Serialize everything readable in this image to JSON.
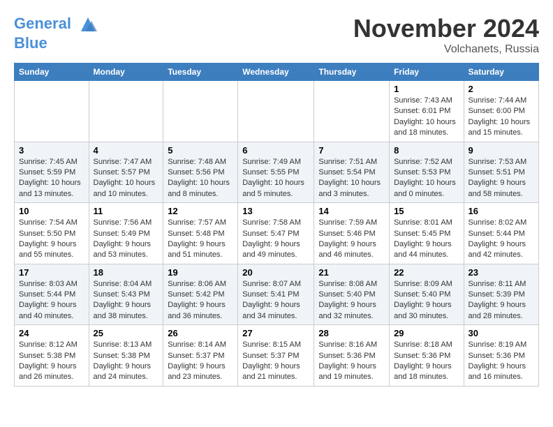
{
  "header": {
    "logo_line1": "General",
    "logo_line2": "Blue",
    "month": "November 2024",
    "location": "Volchanets, Russia"
  },
  "weekdays": [
    "Sunday",
    "Monday",
    "Tuesday",
    "Wednesday",
    "Thursday",
    "Friday",
    "Saturday"
  ],
  "weeks": [
    [
      {
        "day": "",
        "info": ""
      },
      {
        "day": "",
        "info": ""
      },
      {
        "day": "",
        "info": ""
      },
      {
        "day": "",
        "info": ""
      },
      {
        "day": "",
        "info": ""
      },
      {
        "day": "1",
        "info": "Sunrise: 7:43 AM\nSunset: 6:01 PM\nDaylight: 10 hours and 18 minutes."
      },
      {
        "day": "2",
        "info": "Sunrise: 7:44 AM\nSunset: 6:00 PM\nDaylight: 10 hours and 15 minutes."
      }
    ],
    [
      {
        "day": "3",
        "info": "Sunrise: 7:45 AM\nSunset: 5:59 PM\nDaylight: 10 hours and 13 minutes."
      },
      {
        "day": "4",
        "info": "Sunrise: 7:47 AM\nSunset: 5:57 PM\nDaylight: 10 hours and 10 minutes."
      },
      {
        "day": "5",
        "info": "Sunrise: 7:48 AM\nSunset: 5:56 PM\nDaylight: 10 hours and 8 minutes."
      },
      {
        "day": "6",
        "info": "Sunrise: 7:49 AM\nSunset: 5:55 PM\nDaylight: 10 hours and 5 minutes."
      },
      {
        "day": "7",
        "info": "Sunrise: 7:51 AM\nSunset: 5:54 PM\nDaylight: 10 hours and 3 minutes."
      },
      {
        "day": "8",
        "info": "Sunrise: 7:52 AM\nSunset: 5:53 PM\nDaylight: 10 hours and 0 minutes."
      },
      {
        "day": "9",
        "info": "Sunrise: 7:53 AM\nSunset: 5:51 PM\nDaylight: 9 hours and 58 minutes."
      }
    ],
    [
      {
        "day": "10",
        "info": "Sunrise: 7:54 AM\nSunset: 5:50 PM\nDaylight: 9 hours and 55 minutes."
      },
      {
        "day": "11",
        "info": "Sunrise: 7:56 AM\nSunset: 5:49 PM\nDaylight: 9 hours and 53 minutes."
      },
      {
        "day": "12",
        "info": "Sunrise: 7:57 AM\nSunset: 5:48 PM\nDaylight: 9 hours and 51 minutes."
      },
      {
        "day": "13",
        "info": "Sunrise: 7:58 AM\nSunset: 5:47 PM\nDaylight: 9 hours and 49 minutes."
      },
      {
        "day": "14",
        "info": "Sunrise: 7:59 AM\nSunset: 5:46 PM\nDaylight: 9 hours and 46 minutes."
      },
      {
        "day": "15",
        "info": "Sunrise: 8:01 AM\nSunset: 5:45 PM\nDaylight: 9 hours and 44 minutes."
      },
      {
        "day": "16",
        "info": "Sunrise: 8:02 AM\nSunset: 5:44 PM\nDaylight: 9 hours and 42 minutes."
      }
    ],
    [
      {
        "day": "17",
        "info": "Sunrise: 8:03 AM\nSunset: 5:44 PM\nDaylight: 9 hours and 40 minutes."
      },
      {
        "day": "18",
        "info": "Sunrise: 8:04 AM\nSunset: 5:43 PM\nDaylight: 9 hours and 38 minutes."
      },
      {
        "day": "19",
        "info": "Sunrise: 8:06 AM\nSunset: 5:42 PM\nDaylight: 9 hours and 36 minutes."
      },
      {
        "day": "20",
        "info": "Sunrise: 8:07 AM\nSunset: 5:41 PM\nDaylight: 9 hours and 34 minutes."
      },
      {
        "day": "21",
        "info": "Sunrise: 8:08 AM\nSunset: 5:40 PM\nDaylight: 9 hours and 32 minutes."
      },
      {
        "day": "22",
        "info": "Sunrise: 8:09 AM\nSunset: 5:40 PM\nDaylight: 9 hours and 30 minutes."
      },
      {
        "day": "23",
        "info": "Sunrise: 8:11 AM\nSunset: 5:39 PM\nDaylight: 9 hours and 28 minutes."
      }
    ],
    [
      {
        "day": "24",
        "info": "Sunrise: 8:12 AM\nSunset: 5:38 PM\nDaylight: 9 hours and 26 minutes."
      },
      {
        "day": "25",
        "info": "Sunrise: 8:13 AM\nSunset: 5:38 PM\nDaylight: 9 hours and 24 minutes."
      },
      {
        "day": "26",
        "info": "Sunrise: 8:14 AM\nSunset: 5:37 PM\nDaylight: 9 hours and 23 minutes."
      },
      {
        "day": "27",
        "info": "Sunrise: 8:15 AM\nSunset: 5:37 PM\nDaylight: 9 hours and 21 minutes."
      },
      {
        "day": "28",
        "info": "Sunrise: 8:16 AM\nSunset: 5:36 PM\nDaylight: 9 hours and 19 minutes."
      },
      {
        "day": "29",
        "info": "Sunrise: 8:18 AM\nSunset: 5:36 PM\nDaylight: 9 hours and 18 minutes."
      },
      {
        "day": "30",
        "info": "Sunrise: 8:19 AM\nSunset: 5:36 PM\nDaylight: 9 hours and 16 minutes."
      }
    ]
  ]
}
